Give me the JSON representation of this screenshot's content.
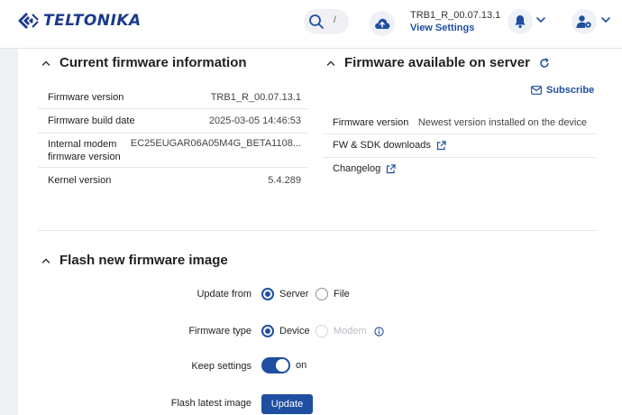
{
  "header": {
    "logo_text": "TELTONIKA",
    "search_shortcut": "/",
    "firmware_version": "TRB1_R_00.07.13.1",
    "view_settings": "View Settings"
  },
  "current_fw": {
    "title": "Current firmware information",
    "rows": [
      {
        "label": "Firmware version",
        "value": "TRB1_R_00.07.13.1"
      },
      {
        "label": "Firmware build date",
        "value": "2025-03-05 14:46:53"
      },
      {
        "label": "Internal modem\nfirmware version",
        "value": "EC25EUGAR06A05M4G_BETA1108..."
      },
      {
        "label": "Kernel version",
        "value": "5.4.289"
      }
    ]
  },
  "server_fw": {
    "title": "Firmware available on server",
    "subscribe": "Subscribe",
    "rows": [
      {
        "label": "Firmware version",
        "value": "Newest version installed on the device"
      }
    ],
    "links": [
      "FW & SDK downloads",
      "Changelog"
    ]
  },
  "flash": {
    "title": "Flash new firmware image",
    "update_from_label": "Update from",
    "update_from_options": [
      "Server",
      "File"
    ],
    "update_from_selected": "Server",
    "fw_type_label": "Firmware type",
    "fw_type_options": [
      "Device",
      "Modem"
    ],
    "fw_type_selected": "Device",
    "keep_settings_label": "Keep settings",
    "keep_settings_value": "on",
    "flash_latest_label": "Flash latest image",
    "update_button": "Update"
  },
  "colors": {
    "accent": "#1f4fa0",
    "logo": "#1b3a8c"
  }
}
